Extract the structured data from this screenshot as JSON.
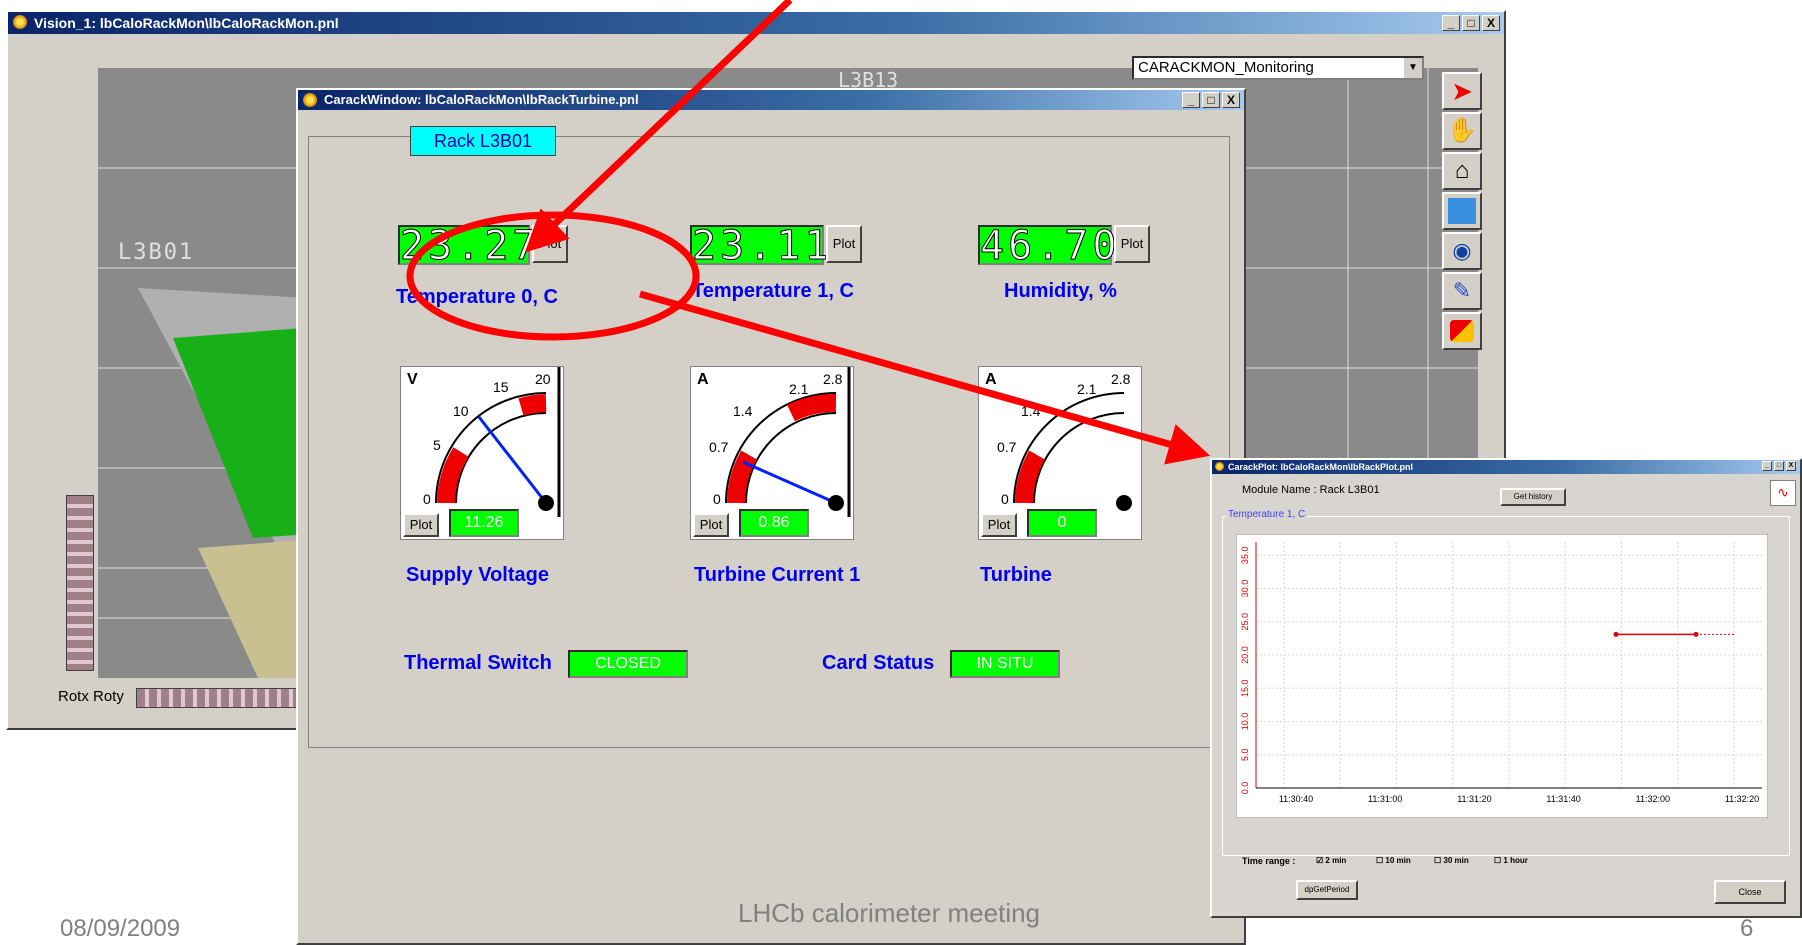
{
  "main_window": {
    "title": "Vision_1: lbCaloRackMon\\lbCaloRackMon.pnl",
    "buttons": [
      "_",
      "□",
      "X"
    ],
    "dropdown_value": "CARACKMON_Monitoring",
    "rack_label_bg": "L3B01",
    "rack_label_top": "L3B13",
    "rotx_label": "Rotx Roty",
    "tools": [
      "pointer-icon",
      "hand-icon",
      "home-icon",
      "page-icon",
      "eye-icon",
      "flashlight-icon",
      "cube-icon"
    ]
  },
  "rack_window": {
    "title": "CarackWindow: lbCaloRackMon\\lbRackTurbine.pnl",
    "rack_name": "Rack L3B01",
    "displays": [
      {
        "value": "23.27",
        "label": "Temperature 0, C",
        "plot": "Plot"
      },
      {
        "value": "23.11",
        "label": "Temperature 1, C",
        "plot": "Plot"
      },
      {
        "value": "46.70",
        "label": "Humidity, %",
        "plot": "Plot"
      }
    ],
    "gauges": [
      {
        "unit": "V",
        "ticks": [
          "0",
          "5",
          "10",
          "15",
          "20"
        ],
        "value": "11.26",
        "label": "Supply Voltage",
        "plot": "Plot"
      },
      {
        "unit": "A",
        "ticks": [
          "0",
          "0.7",
          "1.4",
          "2.1",
          "2.8"
        ],
        "value": "0.86",
        "label": "Turbine Current 1",
        "plot": "Plot"
      },
      {
        "unit": "A",
        "ticks": [
          "0",
          "0.7",
          "1.4",
          "2.1",
          "2.8"
        ],
        "value": "0",
        "label": "Turbine",
        "plot": "Plot"
      }
    ],
    "thermal_switch_label": "Thermal Switch",
    "thermal_switch_value": "CLOSED",
    "card_status_label": "Card Status",
    "card_status_value": "IN SITU"
  },
  "plot_window": {
    "title": "CarackPlot: lbCaloRackMon\\lbRackPlot.pnl",
    "module_name": "Module Name :  Rack L3B01",
    "get_history": "Get history",
    "group_label": "Temperature 1, C",
    "time_range_label": "Time range :",
    "ranges": [
      "2 min",
      "10 min",
      "30 min",
      "1 hour"
    ],
    "dp_button": "dpGetPeriod",
    "close_button": "Close"
  },
  "chart_data": {
    "type": "line",
    "ylabels": [
      "0.0",
      "5.0",
      "10.0",
      "15.0",
      "20.0",
      "25.0",
      "30.0",
      "35.0"
    ],
    "xlabels": [
      "11:30:40",
      "11:31:00",
      "11:31:20",
      "11:31:40",
      "11:32:00",
      "11:32:20"
    ],
    "ylim": [
      0,
      37
    ],
    "series": [
      {
        "values": [
          23.1,
          23.1
        ]
      }
    ]
  },
  "slide": {
    "date": "08/09/2009",
    "footer": "LHCb calorimeter meeting",
    "page": "6"
  },
  "colors": {
    "arrow": "#ff0000",
    "lcd": "#00ff00",
    "label": "#0000ee"
  }
}
